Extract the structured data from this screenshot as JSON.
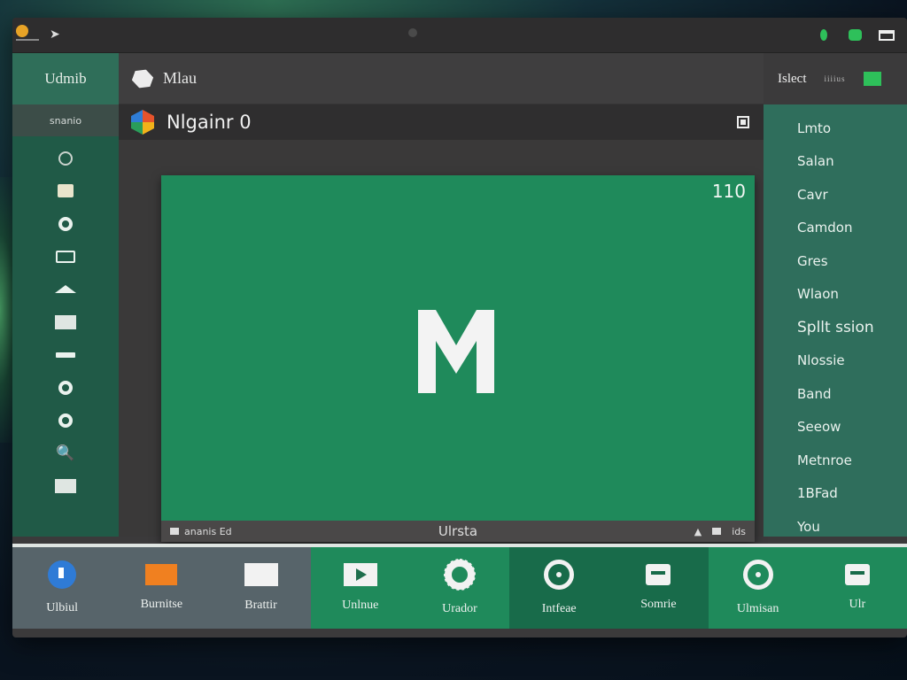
{
  "titlebar": {
    "arrow_icon": "arrow-icon",
    "window_icon": "window-icon"
  },
  "sidebar": {
    "title": "Udmib",
    "subtitle": "snanio",
    "icons": [
      "ring-icon",
      "box-icon",
      "gear-icon",
      "camera-icon",
      "triangle-icon",
      "document-icon",
      "bar-icon",
      "gear-icon",
      "gear-icon",
      "search-icon",
      "trash-icon"
    ]
  },
  "main": {
    "header_title": "Mlau",
    "subheader_title": "Nlgainr 0",
    "player": {
      "counter": "110",
      "bottom_title": "Ulrsta",
      "bottom_left_text": "ananis Ed",
      "bottom_right_text": "ids",
      "center_letter": "M"
    }
  },
  "rightpane": {
    "header_title": "Islect",
    "header_tiny": "iiiius",
    "items": [
      "Lmto",
      "Salan",
      "Cavr",
      "Camdon",
      "Gres",
      "Wlaon",
      "Spllt ssion",
      "Nlossie",
      "Band",
      "Seeow",
      "Metnroe",
      "1BFad",
      "You"
    ]
  },
  "dock": {
    "items": [
      {
        "label": "Ulbiul",
        "style": "gray"
      },
      {
        "label": "Burnitse",
        "style": "gray"
      },
      {
        "label": "Brattir",
        "style": "gray"
      },
      {
        "label": "Unlnue",
        "style": "green"
      },
      {
        "label": "Urador",
        "style": "green"
      },
      {
        "label": "Intfeae",
        "style": "darkgreen"
      },
      {
        "label": "Somrie",
        "style": "darkgreen"
      },
      {
        "label": "Ulmisan",
        "style": "green"
      },
      {
        "label": "Ulr",
        "style": "green"
      }
    ]
  }
}
